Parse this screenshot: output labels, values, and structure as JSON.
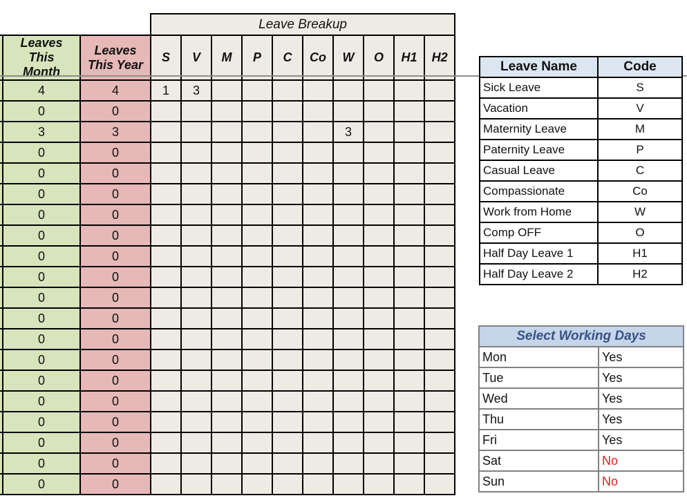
{
  "summary": {
    "month_header": "Leaves This Month",
    "year_header": "Leaves This Year",
    "breakup_title": "Leave Breakup",
    "breakup_codes": [
      "S",
      "V",
      "M",
      "P",
      "C",
      "Co",
      "W",
      "O",
      "H1",
      "H2"
    ],
    "rows": [
      {
        "month": "4",
        "year": "4",
        "breakup": [
          "1",
          "3",
          "",
          "",
          "",
          "",
          "",
          "",
          "",
          ""
        ]
      },
      {
        "month": "0",
        "year": "0",
        "breakup": [
          "",
          "",
          "",
          "",
          "",
          "",
          "",
          "",
          "",
          ""
        ]
      },
      {
        "month": "3",
        "year": "3",
        "breakup": [
          "",
          "",
          "",
          "",
          "",
          "",
          "3",
          "",
          "",
          ""
        ]
      },
      {
        "month": "0",
        "year": "0",
        "breakup": [
          "",
          "",
          "",
          "",
          "",
          "",
          "",
          "",
          "",
          ""
        ]
      },
      {
        "month": "0",
        "year": "0",
        "breakup": [
          "",
          "",
          "",
          "",
          "",
          "",
          "",
          "",
          "",
          ""
        ]
      },
      {
        "month": "0",
        "year": "0",
        "breakup": [
          "",
          "",
          "",
          "",
          "",
          "",
          "",
          "",
          "",
          ""
        ]
      },
      {
        "month": "0",
        "year": "0",
        "breakup": [
          "",
          "",
          "",
          "",
          "",
          "",
          "",
          "",
          "",
          ""
        ]
      },
      {
        "month": "0",
        "year": "0",
        "breakup": [
          "",
          "",
          "",
          "",
          "",
          "",
          "",
          "",
          "",
          ""
        ]
      },
      {
        "month": "0",
        "year": "0",
        "breakup": [
          "",
          "",
          "",
          "",
          "",
          "",
          "",
          "",
          "",
          ""
        ]
      },
      {
        "month": "0",
        "year": "0",
        "breakup": [
          "",
          "",
          "",
          "",
          "",
          "",
          "",
          "",
          "",
          ""
        ]
      },
      {
        "month": "0",
        "year": "0",
        "breakup": [
          "",
          "",
          "",
          "",
          "",
          "",
          "",
          "",
          "",
          ""
        ]
      },
      {
        "month": "0",
        "year": "0",
        "breakup": [
          "",
          "",
          "",
          "",
          "",
          "",
          "",
          "",
          "",
          ""
        ]
      },
      {
        "month": "0",
        "year": "0",
        "breakup": [
          "",
          "",
          "",
          "",
          "",
          "",
          "",
          "",
          "",
          ""
        ]
      },
      {
        "month": "0",
        "year": "0",
        "breakup": [
          "",
          "",
          "",
          "",
          "",
          "",
          "",
          "",
          "",
          ""
        ]
      },
      {
        "month": "0",
        "year": "0",
        "breakup": [
          "",
          "",
          "",
          "",
          "",
          "",
          "",
          "",
          "",
          ""
        ]
      },
      {
        "month": "0",
        "year": "0",
        "breakup": [
          "",
          "",
          "",
          "",
          "",
          "",
          "",
          "",
          "",
          ""
        ]
      },
      {
        "month": "0",
        "year": "0",
        "breakup": [
          "",
          "",
          "",
          "",
          "",
          "",
          "",
          "",
          "",
          ""
        ]
      },
      {
        "month": "0",
        "year": "0",
        "breakup": [
          "",
          "",
          "",
          "",
          "",
          "",
          "",
          "",
          "",
          ""
        ]
      },
      {
        "month": "0",
        "year": "0",
        "breakup": [
          "",
          "",
          "",
          "",
          "",
          "",
          "",
          "",
          "",
          ""
        ]
      },
      {
        "month": "0",
        "year": "0",
        "breakup": [
          "",
          "",
          "",
          "",
          "",
          "",
          "",
          "",
          "",
          ""
        ]
      }
    ]
  },
  "leave_types": {
    "name_header": "Leave Name",
    "code_header": "Code",
    "items": [
      {
        "name": "Sick Leave",
        "code": "S"
      },
      {
        "name": "Vacation",
        "code": "V"
      },
      {
        "name": "Maternity Leave",
        "code": "M"
      },
      {
        "name": "Paternity Leave",
        "code": "P"
      },
      {
        "name": "Casual Leave",
        "code": "C"
      },
      {
        "name": "Compassionate",
        "code": "Co"
      },
      {
        "name": "Work from Home",
        "code": "W"
      },
      {
        "name": "Comp OFF",
        "code": "O"
      },
      {
        "name": "Half Day Leave 1",
        "code": "H1"
      },
      {
        "name": "Half Day Leave 2",
        "code": "H2"
      }
    ]
  },
  "working_days": {
    "title": "Select Working Days",
    "days": [
      {
        "day": "Mon",
        "value": "Yes"
      },
      {
        "day": "Tue",
        "value": "Yes"
      },
      {
        "day": "Wed",
        "value": "Yes"
      },
      {
        "day": "Thu",
        "value": "Yes"
      },
      {
        "day": "Fri",
        "value": "Yes"
      },
      {
        "day": "Sat",
        "value": "No"
      },
      {
        "day": "Sun",
        "value": "No"
      }
    ],
    "no_color": "#e02020"
  }
}
